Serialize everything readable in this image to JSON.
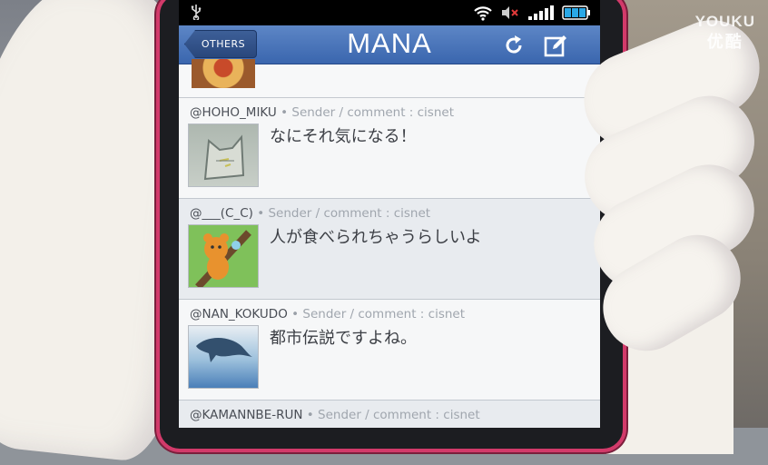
{
  "status_bar": {
    "usb_icon": "usb-icon",
    "wifi_icon": "wifi-icon",
    "mute_icon": "mute-icon",
    "signal_icon": "signal-icon",
    "battery_icon": "battery-icon"
  },
  "header": {
    "back_label": "OTHERS",
    "title": "MANA",
    "refresh_icon": "refresh-icon",
    "compose_icon": "compose-icon"
  },
  "feed": {
    "items": [
      {
        "handle": "@HOHO_MIKU",
        "dot": "•",
        "source": "Sender / comment : cisnet",
        "message": "なにそれ気になる！",
        "avatar": "cat-avatar"
      },
      {
        "handle": "@___(C_C)",
        "dot": "•",
        "source": "Sender / comment : cisnet",
        "message": "人が食べられちゃうらしいよ",
        "avatar": "bear-avatar"
      },
      {
        "handle": "@NAN_KOKUDO",
        "dot": "•",
        "source": "Sender / comment : cisnet",
        "message": "都市伝説ですよね。",
        "avatar": "dolphin-avatar"
      },
      {
        "handle": "@KAMANNBE-RUN",
        "dot": "•",
        "source": "Sender / comment : cisnet"
      }
    ]
  },
  "watermark": {
    "line1": "YOUKU",
    "line2": "优酷"
  },
  "colors": {
    "header_blue": "#3a66ae",
    "phone_frame": "#d23a6a",
    "row_alt": "#e8ebef"
  }
}
